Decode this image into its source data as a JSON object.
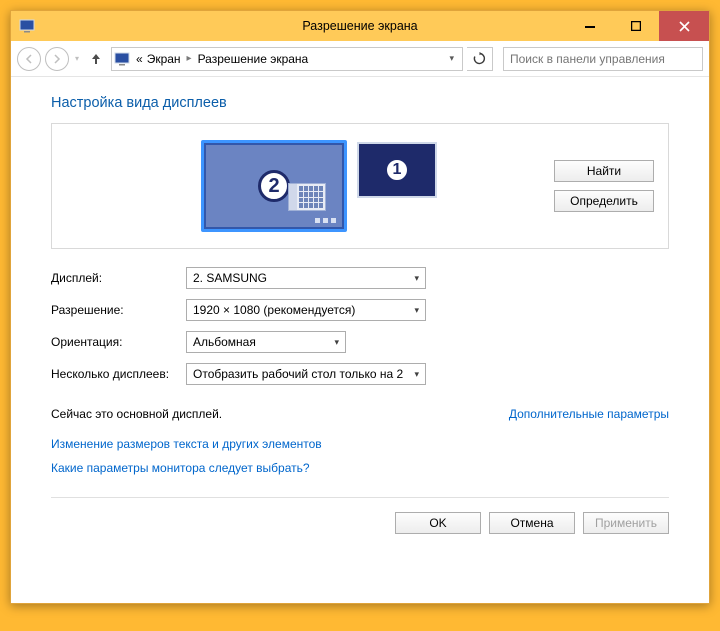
{
  "window": {
    "title": "Разрешение экрана"
  },
  "breadcrumb": {
    "root": "«",
    "item1": "Экран",
    "item2": "Разрешение экрана"
  },
  "search": {
    "placeholder": "Поиск в панели управления"
  },
  "section": {
    "title": "Настройка вида дисплеев"
  },
  "monitors": {
    "primary_number": "2",
    "secondary_number": "1"
  },
  "panel_buttons": {
    "find": "Найти",
    "identify": "Определить"
  },
  "settings": {
    "display_label": "Дисплей:",
    "display_value": "2. SAMSUNG",
    "resolution_label": "Разрешение:",
    "resolution_value": "1920 × 1080 (рекомендуется)",
    "orientation_label": "Ориентация:",
    "orientation_value": "Альбомная",
    "multi_label": "Несколько дисплеев:",
    "multi_value": "Отобразить рабочий стол только на 2"
  },
  "status": {
    "main_display": "Сейчас это основной дисплей.",
    "advanced": "Дополнительные параметры"
  },
  "links": {
    "text_size": "Изменение размеров текста и других элементов",
    "help": "Какие параметры монитора следует выбрать?"
  },
  "buttons": {
    "ok": "OK",
    "cancel": "Отмена",
    "apply": "Применить"
  }
}
